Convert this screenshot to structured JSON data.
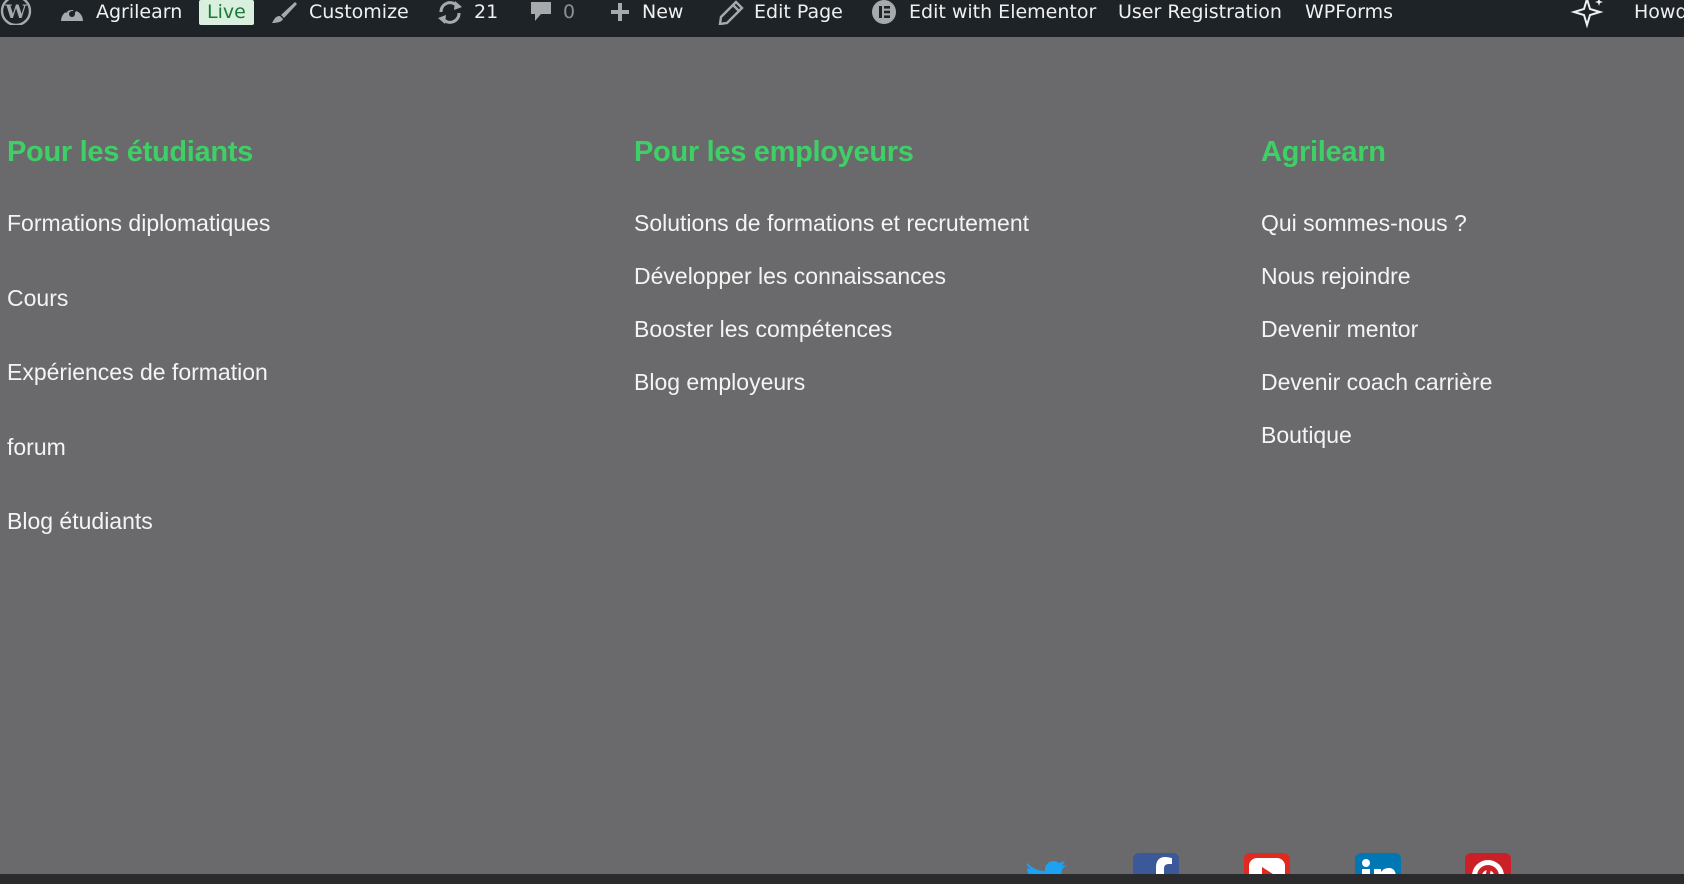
{
  "adminbar": {
    "site_name": "Agrilearn",
    "live_badge": "Live",
    "customize": "Customize",
    "updates_count": "21",
    "comments_count": "0",
    "new": "New",
    "edit_page": "Edit Page",
    "elementor": "Edit with Elementor",
    "user_registration": "User Registration",
    "wpforms": "WPForms",
    "howdy": "Howdy"
  },
  "footer": {
    "students": {
      "title": "Pour les étudiants",
      "links": [
        "Formations diplomatiques",
        "Cours",
        "Expériences de formation",
        "forum",
        "Blog étudiants"
      ]
    },
    "employers": {
      "title": "Pour les employeurs",
      "links": [
        "Solutions de formations et recrutement",
        "Développer les connaissances",
        "Booster les compétences",
        "Blog employeurs"
      ]
    },
    "agrilearn": {
      "title": "Agrilearn",
      "links": [
        "Qui sommes-nous ?",
        "Nous rejoindre",
        "Devenir mentor",
        "Devenir coach carrière",
        "Boutique"
      ]
    }
  },
  "social": [
    {
      "icon": "twitter-icon",
      "color": "#1da1f2"
    },
    {
      "icon": "facebook-icon",
      "color": "#3b5998"
    },
    {
      "icon": "youtube-icon",
      "color": "#e02a20"
    },
    {
      "icon": "linkedin-icon",
      "color": "#0077b5"
    },
    {
      "icon": "pinterest-icon",
      "color": "#cb2027"
    }
  ],
  "colors": {
    "background": "#6a6a6c",
    "heading": "#3fcf67",
    "link": "#f4f4f4",
    "adminbar": "#1d2327"
  }
}
